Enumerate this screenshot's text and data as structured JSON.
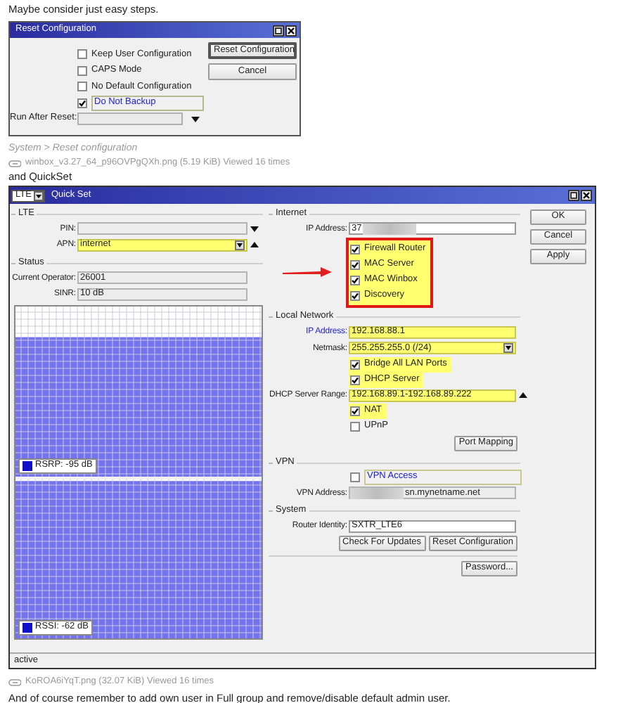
{
  "intro": "Maybe consider just easy steps.",
  "reset_dialog": {
    "title": "Reset Configuration",
    "options": [
      {
        "label": "Keep User Configuration",
        "checked": false,
        "focused": false
      },
      {
        "label": "CAPS Mode",
        "checked": false,
        "focused": false
      },
      {
        "label": "No Default Configuration",
        "checked": false,
        "focused": false
      },
      {
        "label": "Do Not Backup",
        "checked": true,
        "focused": true
      }
    ],
    "buttons": [
      {
        "label": "Reset Configuration",
        "default": true
      },
      {
        "label": "Cancel",
        "default": false
      }
    ],
    "run_after_reset_label": "Run After Reset:"
  },
  "caption": "System > Reset configuration",
  "attachment_1": "winbox_v3.27_64_p96OVPgQXh.png (5.19 KiB) Viewed 16 times",
  "lead_in": "and QuickSet",
  "quickset": {
    "mode": "LTE",
    "title": "Quick Set",
    "left_sections": [
      {
        "title": "LTE",
        "items": [
          {
            "kind": "field",
            "label": "PIN:",
            "readonly": true,
            "down_arrow": true
          },
          {
            "kind": "field",
            "label": "APN:",
            "value": "internet",
            "highlighted": true,
            "dropdown": true,
            "up_arrow": true
          }
        ]
      },
      {
        "title": "Status",
        "items": [
          {
            "kind": "field",
            "label": "Current Operator:",
            "value": "26001",
            "readonly": true
          },
          {
            "kind": "field",
            "label": "SINR:",
            "value": "10 dB",
            "readonly": true
          }
        ]
      }
    ],
    "graphs": [
      {
        "legend": "RSRP: -95 dB"
      },
      {
        "legend": "RSSI: -62 dB"
      }
    ],
    "right_sections": [
      {
        "title": "Internet",
        "items": [
          {
            "kind": "field",
            "label": "IP Address:",
            "value": "37",
            "redacted_after": true
          },
          {
            "kind": "group",
            "annotated": true,
            "items": [
              {
                "kind": "check",
                "label": "Firewall Router",
                "checked": true
              },
              {
                "kind": "check",
                "label": "MAC Server",
                "checked": true
              },
              {
                "kind": "check",
                "label": "MAC Winbox",
                "checked": true
              },
              {
                "kind": "check",
                "label": "Discovery",
                "checked": true
              }
            ]
          }
        ]
      },
      {
        "title": "Local Network",
        "items": [
          {
            "kind": "field",
            "label": "IP Address:",
            "link": true,
            "value": "192.168.88.1",
            "highlighted": true
          },
          {
            "kind": "field",
            "label": "Netmask:",
            "value": "255.255.255.0 (/24)",
            "highlighted": true,
            "dropdown": true
          },
          {
            "kind": "check",
            "label": "Bridge All LAN Ports",
            "checked": true,
            "highlighted": true
          },
          {
            "kind": "check",
            "label": "DHCP Server",
            "checked": true,
            "highlighted": true
          },
          {
            "kind": "field",
            "label": "DHCP Server Range:",
            "value": "192.168.89.1-192.168.89.222",
            "highlighted": true,
            "up_arrow": true
          },
          {
            "kind": "check",
            "label": "NAT",
            "checked": true,
            "highlighted": true
          },
          {
            "kind": "check",
            "label": "UPnP",
            "checked": false
          },
          {
            "kind": "buttons",
            "labels": [
              "Port Mapping"
            ]
          }
        ]
      },
      {
        "title": "VPN",
        "items": [
          {
            "kind": "check",
            "label": "VPN Access",
            "checked": false,
            "link": true,
            "focused": true
          },
          {
            "kind": "field",
            "label": "VPN Address:",
            "value": "sn.mynetname.net",
            "redacted_before": true,
            "readonly": true
          }
        ]
      },
      {
        "title": "System",
        "items": [
          {
            "kind": "field",
            "label": "Router Identity:",
            "value": "SXTR_LTE6"
          },
          {
            "kind": "buttons",
            "labels": [
              "Check For Updates",
              "Reset Configuration"
            ]
          },
          {
            "kind": "divider"
          },
          {
            "kind": "buttons",
            "labels": [
              "Password..."
            ]
          }
        ]
      }
    ],
    "buttons": [
      "OK",
      "Cancel",
      "Apply"
    ],
    "status": "active"
  },
  "attachment_2": "KoROA6iYqT.png (32.07 KiB) Viewed 16 times",
  "outro": "And of course remember to add own user in Full group and remove/disable default admin user."
}
